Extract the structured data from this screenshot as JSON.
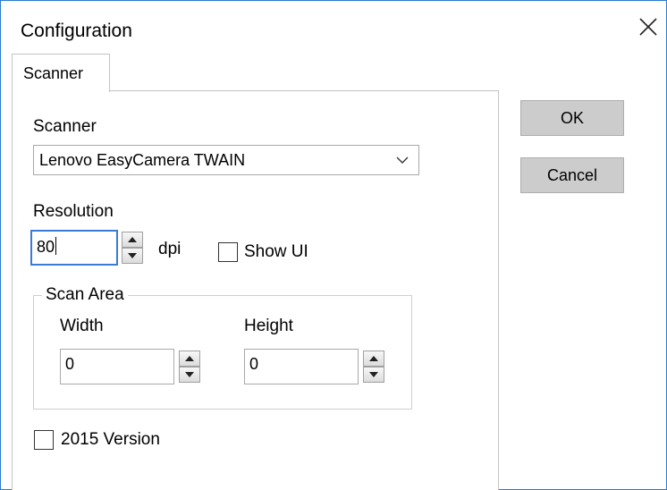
{
  "window": {
    "title": "Configuration",
    "close_icon": "close-icon"
  },
  "tabs": [
    {
      "label": "Scanner",
      "active": true
    }
  ],
  "scanner": {
    "label": "Scanner",
    "selected": "Lenovo EasyCamera TWAIN"
  },
  "resolution": {
    "label": "Resolution",
    "value": "80",
    "unit": "dpi"
  },
  "show_ui": {
    "label": "Show UI",
    "checked": false
  },
  "scan_area": {
    "title": "Scan Area",
    "width_label": "Width",
    "width_value": "0",
    "height_label": "Height",
    "height_value": "0"
  },
  "version_2015": {
    "label": "2015 Version",
    "checked": false
  },
  "buttons": {
    "ok": "OK",
    "cancel": "Cancel"
  },
  "colors": {
    "window_border": "#2b7ccf",
    "button_bg": "#cccccc",
    "focus_border": "#3a7bd5"
  }
}
